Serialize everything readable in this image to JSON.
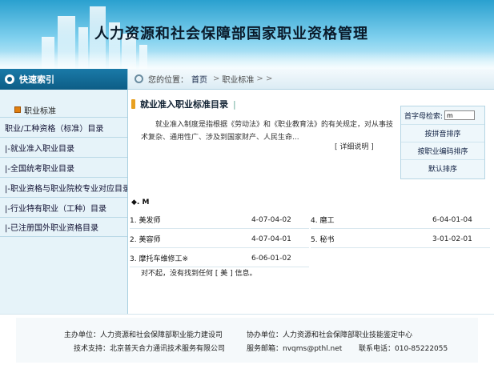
{
  "banner": {
    "title": "人力资源和社会保障部国家职业资格管理"
  },
  "sidebar": {
    "header": "快速索引",
    "sub": "职业标准",
    "items": [
      "职业/工种资格（标准）目录",
      "|-就业准入职业目录",
      "|-全国统考职业目录",
      "|-职业资格与职业院校专业对应目录",
      "|-行业特有职业（工种）目录",
      "|-已注册国外职业资格目录"
    ]
  },
  "breadcrumb": {
    "prefix": "您的位置：",
    "home": "首页",
    "sep1": ">",
    "current": "职业标准",
    "sep2": "> >"
  },
  "main": {
    "section_title": "就业准入职业标准目录",
    "section_bar": "|",
    "intro": "就业准入制度是指根据《劳动法》和《职业教育法》的有关规定，对从事技术复杂、通用性广、涉及到国家财产、人民生命...",
    "more": "[ 详细说明 ]"
  },
  "search_panel": {
    "label": "首字母检索:",
    "input_value": "m",
    "buttons": [
      "按拼音排序",
      "按职业编码排序",
      "默认排序"
    ]
  },
  "results": {
    "letter_heading": "◆. M",
    "jobs": [
      {
        "name": "1. 美发师",
        "code": "4-07-04-02"
      },
      {
        "name": "4. 磨工",
        "code": "6-04-01-04"
      },
      {
        "name": "2. 美容师",
        "code": "4-07-04-01"
      },
      {
        "name": "5. 秘书",
        "code": "3-01-02-01"
      },
      {
        "name": "3. 摩托车维修工※",
        "code": "6-06-01-02"
      }
    ],
    "not_found": "对不起，没有找到任何 [ 美 ] 信息。"
  },
  "footer": {
    "host": "主办单位：人力资源和社会保障部职业能力建设司",
    "cohost": "协办单位：人力资源和社会保障部职业技能鉴定中心",
    "tech": "技术支持：北京普天合力通讯技术服务有限公司",
    "email": "服务邮箱：nvqms@pthl.net",
    "phone": "联系电话：010-85222055"
  }
}
